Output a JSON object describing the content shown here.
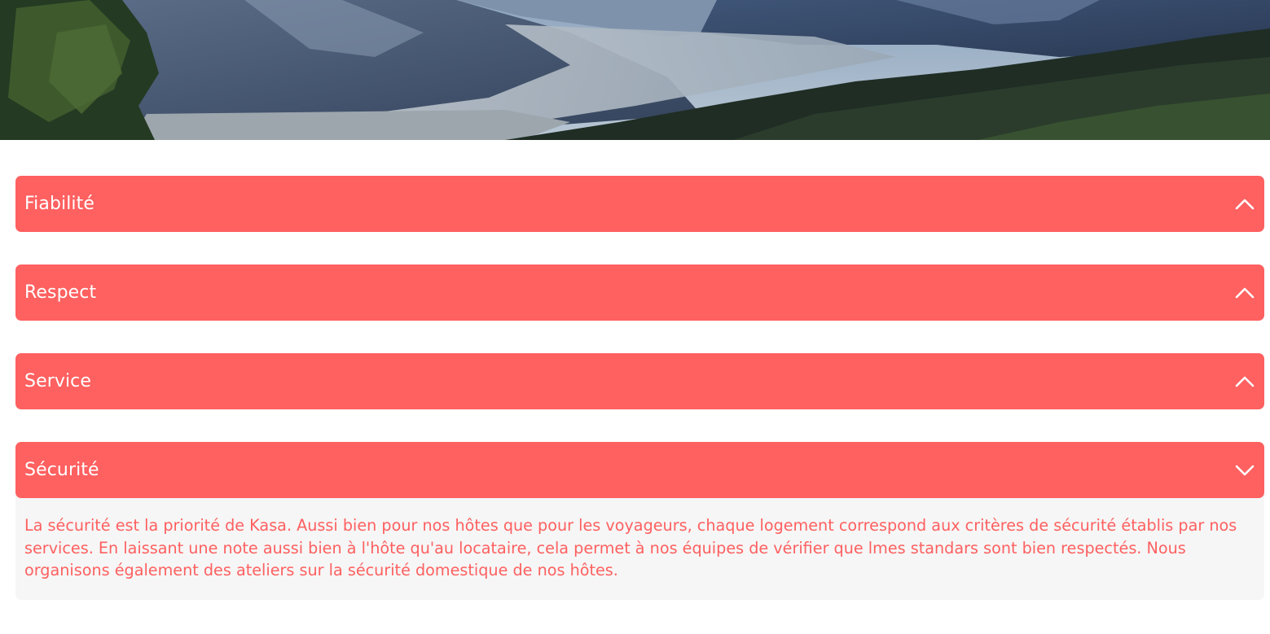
{
  "banner": {
    "image_alt": "mountain valley landscape"
  },
  "collapses": [
    {
      "title": "Fiabilité",
      "icon": "chevron-up-icon",
      "open": false
    },
    {
      "title": "Respect",
      "icon": "chevron-up-icon",
      "open": false
    },
    {
      "title": "Service",
      "icon": "chevron-up-icon",
      "open": false
    },
    {
      "title": "Sécurité",
      "icon": "chevron-down-icon",
      "open": true,
      "content": "La sécurité est la priorité de Kasa. Aussi bien pour nos hôtes que pour les voyageurs, chaque logement correspond aux critères de sécurité établis par nos services. En laissant une note aussi bien à l'hôte qu'au locataire, cela permet à nos équipes de vérifier que lmes standars sont bien respectés. Nous organisons également des ateliers sur la sécurité domestique de nos hôtes."
    }
  ],
  "colors": {
    "accent": "#FF6060",
    "panel_background": "#F6F6F6",
    "header_text": "#FFFFFF"
  }
}
